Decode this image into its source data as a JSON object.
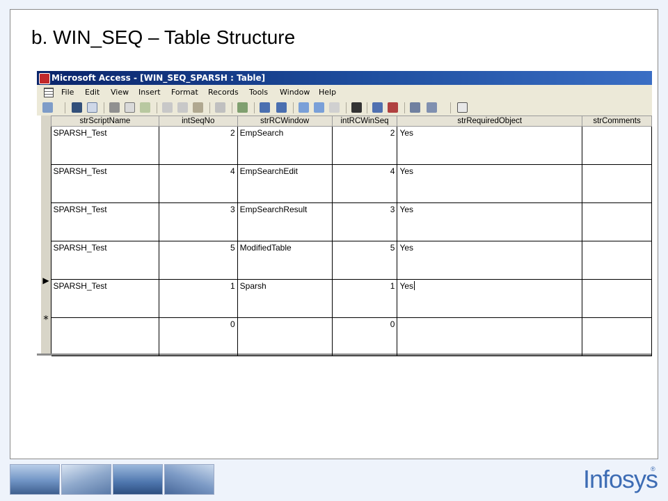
{
  "slide": {
    "title": "b. WIN_SEQ – Table Structure"
  },
  "window": {
    "title": "Microsoft Access - [WIN_SEQ_SPARSH : Table]"
  },
  "menu": [
    "File",
    "Edit",
    "View",
    "Insert",
    "Format",
    "Records",
    "Tools",
    "Window",
    "Help"
  ],
  "toolbar_icons": [
    "view-icon",
    "save-icon",
    "search-icon",
    "print-icon",
    "print-preview-icon",
    "spelling-icon",
    "cut-icon",
    "copy-icon",
    "paste-icon",
    "undo-icon",
    "hyperlink-icon",
    "sort-ascending-icon",
    "sort-descending-icon",
    "filter-by-selection-icon",
    "filter-by-form-icon",
    "apply-filter-icon",
    "find-icon",
    "new-record-icon",
    "delete-record-icon",
    "database-window-icon",
    "new-object-icon",
    "help-icon"
  ],
  "table": {
    "columns": [
      "strScriptName",
      "intSeqNo",
      "strRCWindow",
      "intRCWinSeq",
      "strRequiredObject",
      "strComments"
    ],
    "rows": [
      [
        "SPARSH_Test",
        "2",
        "EmpSearch",
        "2",
        "Yes",
        ""
      ],
      [
        "SPARSH_Test",
        "4",
        "EmpSearchEdit",
        "4",
        "Yes",
        ""
      ],
      [
        "SPARSH_Test",
        "3",
        "EmpSearchResult",
        "3",
        "Yes",
        ""
      ],
      [
        "SPARSH_Test",
        "5",
        "ModifiedTable",
        "5",
        "Yes",
        ""
      ],
      [
        "SPARSH_Test",
        "1",
        "Sparsh",
        "1",
        "Yes",
        ""
      ],
      [
        "",
        "0",
        "",
        "0",
        "",
        ""
      ]
    ],
    "row_selectors": [
      "",
      "",
      "",
      "",
      "▶",
      "*"
    ]
  },
  "footer": {
    "logo": "Infosys",
    "logo_mark": "®"
  },
  "colors": {
    "titlebar": "#0a246a",
    "logo": "#3d6cb4",
    "chrome": "#ece9d8"
  }
}
